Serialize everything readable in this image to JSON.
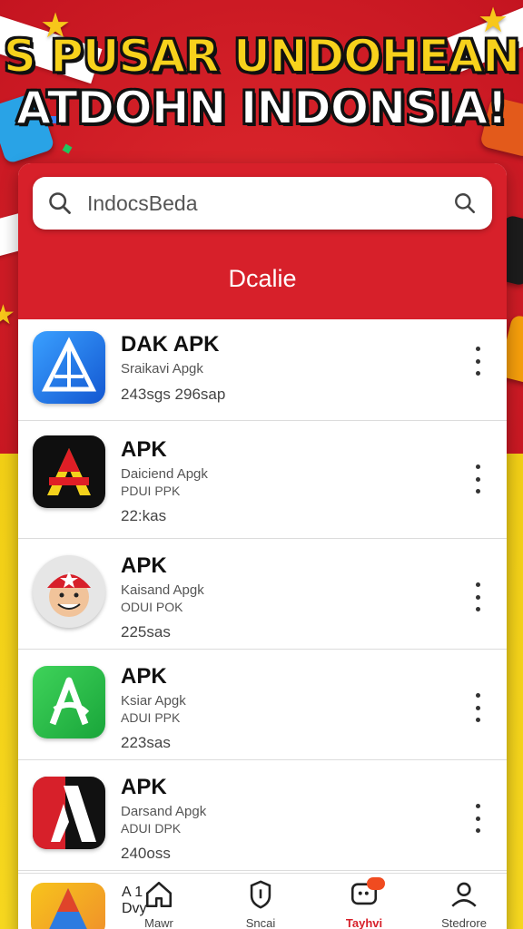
{
  "headline": {
    "line1": "S PUSAR UNDOHEAN",
    "line2": "ATDOHN INDONSIA!"
  },
  "search": {
    "placeholder": "IndocsBeda",
    "left_icon": "search-icon",
    "right_icon": "search-icon"
  },
  "card_title": "Dcalie",
  "apps": [
    {
      "name": "DAK APK",
      "line1": "Sraikavi Apgk",
      "line2": "",
      "meta": "243sgs 296sap",
      "icon": "triangle-logo-icon"
    },
    {
      "name": "APK",
      "line1": "Daiciend Apgk",
      "line2": "PDUI PPK",
      "meta": "22:kas",
      "icon": "a-logo-black-icon"
    },
    {
      "name": "APK",
      "line1": "Kaisand Apgk",
      "line2": "ODUI POK",
      "meta": "225sas",
      "icon": "avatar-character-icon"
    },
    {
      "name": "APK",
      "line1": "Ksiar Apgk",
      "line2": "ADUI PPK",
      "meta": "223sas",
      "icon": "a-logo-green-icon"
    },
    {
      "name": "APK",
      "line1": "Darsand Apgk",
      "line2": "ADUI DPK",
      "meta": "240oss",
      "icon": "a-logo-red-icon"
    }
  ],
  "partial_item": {
    "line1": "A 1",
    "line2": "Dvy"
  },
  "nav": [
    {
      "label": "Mawr",
      "icon": "home-icon"
    },
    {
      "label": "Sncai",
      "icon": "shield-icon"
    },
    {
      "label": "Tayhvi",
      "icon": "chat-icon",
      "badge": ""
    },
    {
      "label": "Stedrore",
      "icon": "person-icon"
    }
  ],
  "colors": {
    "brand_red": "#d7202a",
    "headline_yellow": "#f7d21c",
    "background_yellow": "#f7d81f"
  }
}
